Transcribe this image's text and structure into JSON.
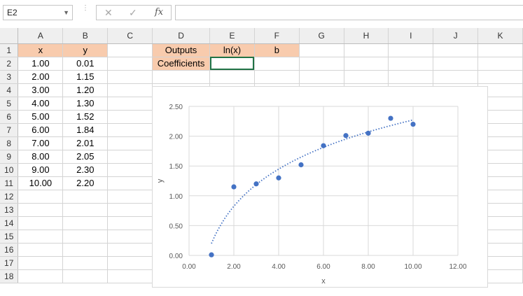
{
  "formula_bar": {
    "name_box": "E2",
    "cancel_icon": "✕",
    "enter_icon": "✓",
    "function_icon": "fx",
    "formula": ""
  },
  "columns": [
    "A",
    "B",
    "C",
    "D",
    "E",
    "F",
    "G",
    "H",
    "I",
    "J",
    "K"
  ],
  "rows": [
    [
      "x",
      "y",
      "",
      "Outputs",
      "ln(x)",
      "b",
      "",
      "",
      "",
      "",
      ""
    ],
    [
      "1.00",
      "0.01",
      "",
      "Coefficients",
      "",
      "",
      "",
      "",
      "",
      "",
      ""
    ],
    [
      "2.00",
      "1.15",
      "",
      "",
      "",
      "",
      "",
      "",
      "",
      "",
      ""
    ],
    [
      "3.00",
      "1.20",
      "",
      "",
      "",
      "",
      "",
      "",
      "",
      "",
      ""
    ],
    [
      "4.00",
      "1.30",
      "",
      "",
      "",
      "",
      "",
      "",
      "",
      "",
      ""
    ],
    [
      "5.00",
      "1.52",
      "",
      "",
      "",
      "",
      "",
      "",
      "",
      "",
      ""
    ],
    [
      "6.00",
      "1.84",
      "",
      "",
      "",
      "",
      "",
      "",
      "",
      "",
      ""
    ],
    [
      "7.00",
      "2.01",
      "",
      "",
      "",
      "",
      "",
      "",
      "",
      "",
      ""
    ],
    [
      "8.00",
      "2.05",
      "",
      "",
      "",
      "",
      "",
      "",
      "",
      "",
      ""
    ],
    [
      "9.00",
      "2.30",
      "",
      "",
      "",
      "",
      "",
      "",
      "",
      "",
      ""
    ],
    [
      "10.00",
      "2.20",
      "",
      "",
      "",
      "",
      "",
      "",
      "",
      "",
      ""
    ],
    [
      "",
      "",
      "",
      "",
      "",
      "",
      "",
      "",
      "",
      "",
      ""
    ],
    [
      "",
      "",
      "",
      "",
      "",
      "",
      "",
      "",
      "",
      "",
      ""
    ],
    [
      "",
      "",
      "",
      "",
      "",
      "",
      "",
      "",
      "",
      "",
      ""
    ],
    [
      "",
      "",
      "",
      "",
      "",
      "",
      "",
      "",
      "",
      "",
      ""
    ],
    [
      "",
      "",
      "",
      "",
      "",
      "",
      "",
      "",
      "",
      "",
      ""
    ],
    [
      "",
      "",
      "",
      "",
      "",
      "",
      "",
      "",
      "",
      "",
      ""
    ],
    [
      "",
      "",
      "",
      "",
      "",
      "",
      "",
      "",
      "",
      "",
      ""
    ]
  ],
  "highlighted_cells": [
    "A1",
    "B1",
    "D1",
    "E1",
    "F1",
    "D2"
  ],
  "selected_cell": "E2",
  "colors": {
    "header_fill": "#f8cbad",
    "marker": "#4472c4",
    "selection": "#217346"
  },
  "chart_data": {
    "type": "scatter",
    "title": "",
    "xlabel": "x",
    "ylabel": "y",
    "xlim": [
      0,
      12
    ],
    "ylim": [
      0,
      2.5
    ],
    "x_ticks": [
      "0.00",
      "2.00",
      "4.00",
      "6.00",
      "8.00",
      "10.00",
      "12.00"
    ],
    "y_ticks": [
      "0.00",
      "0.50",
      "1.00",
      "1.50",
      "2.00",
      "2.50"
    ],
    "grid": true,
    "series": [
      {
        "x": [
          1,
          2,
          3,
          4,
          5,
          6,
          7,
          8,
          9,
          10
        ],
        "y": [
          0.01,
          1.15,
          1.2,
          1.3,
          1.52,
          1.84,
          2.01,
          2.05,
          2.3,
          2.2
        ]
      }
    ],
    "trendline": {
      "type": "logarithmic",
      "style": "dotted",
      "slope": 0.9,
      "intercept": 0.2
    }
  }
}
